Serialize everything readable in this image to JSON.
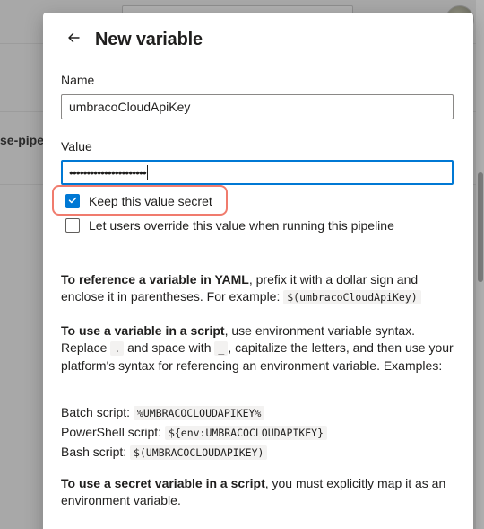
{
  "background": {
    "partial_text": "se-pipe"
  },
  "dialog": {
    "title": "New variable",
    "name_field": {
      "label": "Name",
      "value": "umbracoCloudApiKey"
    },
    "value_field": {
      "label": "Value",
      "masked_value": "••••••••••••••••••••••"
    },
    "keep_secret": {
      "label": "Keep this value secret",
      "checked": true
    },
    "allow_override": {
      "label": "Let users override this value when running this pipeline",
      "checked": false
    },
    "help": {
      "yaml_bold": "To reference a variable in YAML",
      "yaml_text": ", prefix it with a dollar sign and enclose it in parentheses. For example: ",
      "yaml_code": "$(umbracoCloudApiKey)",
      "script_bold": "To use a variable in a script",
      "script_text1": ", use environment variable syntax. Replace ",
      "script_code_dot": ".",
      "script_text2": " and space with ",
      "script_code_underscore": "_",
      "script_text3": ", capitalize the letters, and then use your platform's syntax for referencing an environment variable. Examples:",
      "batch_label": "Batch script: ",
      "batch_code": "%UMBRACOCLOUDAPIKEY%",
      "powershell_label": "PowerShell script: ",
      "powershell_code": "${env:UMBRACOCLOUDAPIKEY}",
      "bash_label": "Bash script: ",
      "bash_code": "$(UMBRACOCLOUDAPIKEY)",
      "secret_bold": "To use a secret variable in a script",
      "secret_text": ", you must explicitly map it as an environment variable."
    }
  },
  "colors": {
    "accent": "#0078d4",
    "highlight": "#f07b6d"
  }
}
